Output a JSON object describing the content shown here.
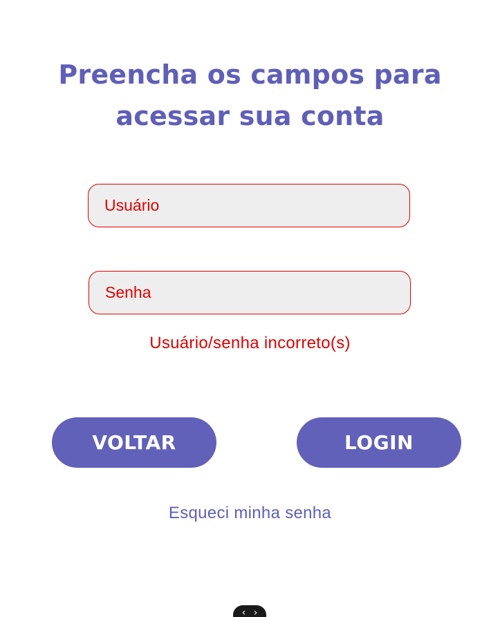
{
  "header": {
    "title_line1": "Preencha os campos para",
    "title_line2": "acessar sua conta"
  },
  "form": {
    "username_placeholder": "Usuário",
    "username_value": "",
    "password_placeholder": "Senha",
    "password_value": "",
    "error_message": "Usuário/senha incorreto(s)"
  },
  "actions": {
    "back_label": "VOLTAR",
    "login_label": "LOGIN",
    "forgot_label": "Esqueci minha senha"
  },
  "devtools": {
    "icon": "code-brackets-icon",
    "glyph": "‹ ›"
  },
  "colors": {
    "accent": "#6161b9",
    "error": "#e00000",
    "field_bg": "#eeeeee"
  }
}
